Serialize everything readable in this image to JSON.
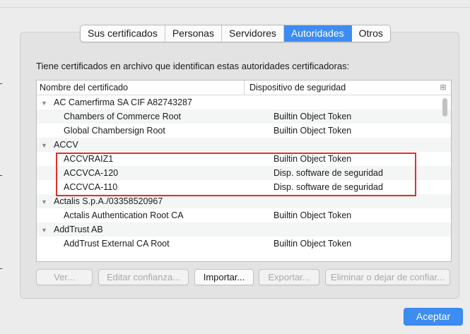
{
  "tabs": [
    {
      "label": "Sus certificados",
      "active": false
    },
    {
      "label": "Personas",
      "active": false
    },
    {
      "label": "Servidores",
      "active": false
    },
    {
      "label": "Autoridades",
      "active": true
    },
    {
      "label": "Otros",
      "active": false
    }
  ],
  "description": "Tiene certificados en archivo que identifican estas autoridades certificadoras:",
  "table": {
    "headers": {
      "name": "Nombre del certificado",
      "device": "Dispositivo de seguridad"
    },
    "rows": [
      {
        "type": "group",
        "name": "AC Camerfirma SA CIF A82743287",
        "device": ""
      },
      {
        "type": "child",
        "name": "Chambers of Commerce Root",
        "device": "Builtin Object Token"
      },
      {
        "type": "child",
        "name": "Global Chambersign Root",
        "device": "Builtin Object Token"
      },
      {
        "type": "group",
        "name": "ACCV",
        "device": ""
      },
      {
        "type": "child",
        "name": "ACCVRAIZ1",
        "device": "Builtin Object Token"
      },
      {
        "type": "child",
        "name": "ACCVCA-120",
        "device": "Disp. software de seguridad"
      },
      {
        "type": "child",
        "name": "ACCVCA-110",
        "device": "Disp. software de seguridad"
      },
      {
        "type": "group",
        "name": "Actalis S.p.A./03358520967",
        "device": ""
      },
      {
        "type": "child",
        "name": "Actalis Authentication Root CA",
        "device": "Builtin Object Token"
      },
      {
        "type": "group",
        "name": "AddTrust AB",
        "device": ""
      },
      {
        "type": "child",
        "name": "AddTrust External CA Root",
        "device": "Builtin Object Token"
      }
    ]
  },
  "buttons": {
    "view": "Ver...",
    "edit_trust": "Editar confianza...",
    "import": "Importar...",
    "export": "Exportar...",
    "delete": "Eliminar o dejar de confiar...",
    "accept": "Aceptar"
  },
  "colors": {
    "accent": "#3d8cf2",
    "highlight": "#e0302a"
  },
  "icons": {
    "expand": "triangle-down-icon",
    "column_picker": "column-picker-icon"
  }
}
